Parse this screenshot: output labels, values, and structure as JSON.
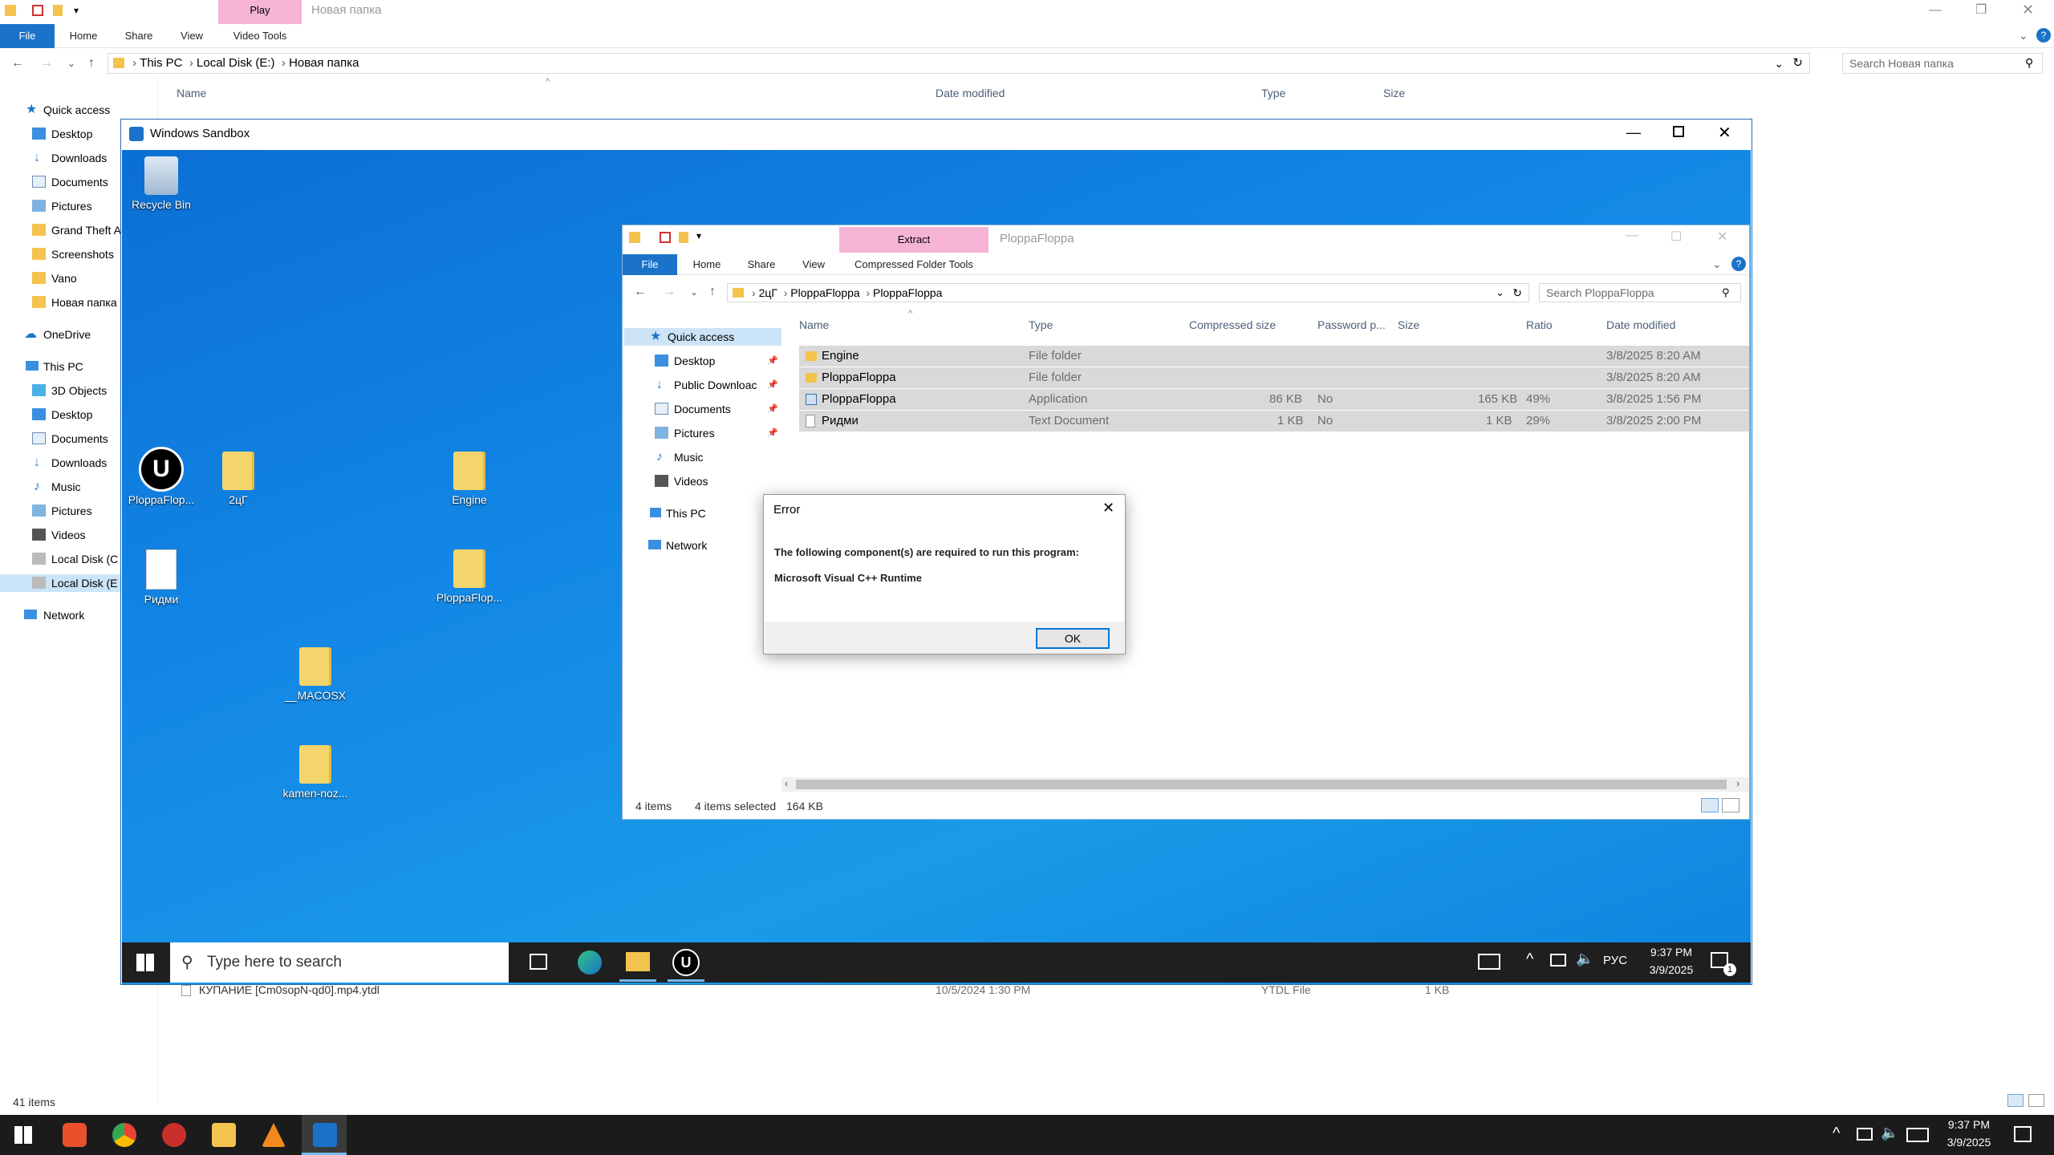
{
  "host": {
    "title_path": "Новая папка",
    "contextual_tab": "Play",
    "ribbon_tabs": [
      "File",
      "Home",
      "Share",
      "View",
      "Video Tools"
    ],
    "breadcrumb": [
      "This PC",
      "Local Disk (E:)",
      "Новая папка"
    ],
    "search_placeholder": "Search Новая папка",
    "columns": [
      "Name",
      "Date modified",
      "Type",
      "Size"
    ],
    "nav": [
      "Quick access",
      "Desktop",
      "Downloads",
      "Documents",
      "Pictures",
      "Grand Theft A",
      "Screenshots",
      "Vano",
      "Новая папка",
      "OneDrive",
      "This PC",
      "3D Objects",
      "Desktop",
      "Documents",
      "Downloads",
      "Music",
      "Pictures",
      "Videos",
      "Local Disk (C",
      "Local Disk (E",
      "Network"
    ],
    "visible_file": {
      "name": "КУПАНИЕ [Cm0sopN-qd0].mp4.ytdl",
      "date": "10/5/2024 1:30 PM",
      "type": "YTDL File",
      "size": "1 KB"
    },
    "status": "41 items",
    "taskbar_time": "9:37 PM",
    "taskbar_date": "3/9/2025"
  },
  "sandbox": {
    "title": "Windows Sandbox",
    "desktop_icons": [
      "Recycle Bin",
      "PloppaFlop...",
      "2цГ",
      "Engine",
      "Ридми",
      "PloppaFlop...",
      "__MACOSX",
      "kamen-noz..."
    ],
    "search_placeholder": "Type here to search",
    "tray_lang": "РУС",
    "time": "9:37 PM",
    "date": "3/9/2025",
    "notif_count": "1"
  },
  "inner": {
    "contextual_tab": "Extract",
    "title": "PloppaFloppa",
    "ribbon_tabs": [
      "File",
      "Home",
      "Share",
      "View",
      "Compressed Folder Tools"
    ],
    "breadcrumb": [
      "2цГ",
      "PloppaFloppa",
      "PloppaFloppa"
    ],
    "search_placeholder": "Search PloppaFloppa",
    "nav": [
      "Quick access",
      "Desktop",
      "Public Downloac",
      "Documents",
      "Pictures",
      "Music",
      "Videos",
      "This PC",
      "Network"
    ],
    "columns": [
      "Name",
      "Type",
      "Compressed size",
      "Password p...",
      "Size",
      "Ratio",
      "Date modified"
    ],
    "rows": [
      {
        "name": "Engine",
        "type": "File folder",
        "csize": "",
        "pwd": "",
        "size": "",
        "ratio": "",
        "date": "3/8/2025 8:20 AM"
      },
      {
        "name": "PloppaFloppa",
        "type": "File folder",
        "csize": "",
        "pwd": "",
        "size": "",
        "ratio": "",
        "date": "3/8/2025 8:20 AM"
      },
      {
        "name": "PloppaFloppa",
        "type": "Application",
        "csize": "86 KB",
        "pwd": "No",
        "size": "165 KB",
        "ratio": "49%",
        "date": "3/8/2025 1:56 PM"
      },
      {
        "name": "Ридми",
        "type": "Text Document",
        "csize": "1 KB",
        "pwd": "No",
        "size": "1 KB",
        "ratio": "29%",
        "date": "3/8/2025 2:00 PM"
      }
    ],
    "status_items": "4 items",
    "status_selected": "4 items selected",
    "status_size": "164 KB"
  },
  "dialog": {
    "title": "Error",
    "message": "The following component(s) are required to run this program:",
    "component": "Microsoft Visual C++ Runtime",
    "ok": "OK"
  }
}
